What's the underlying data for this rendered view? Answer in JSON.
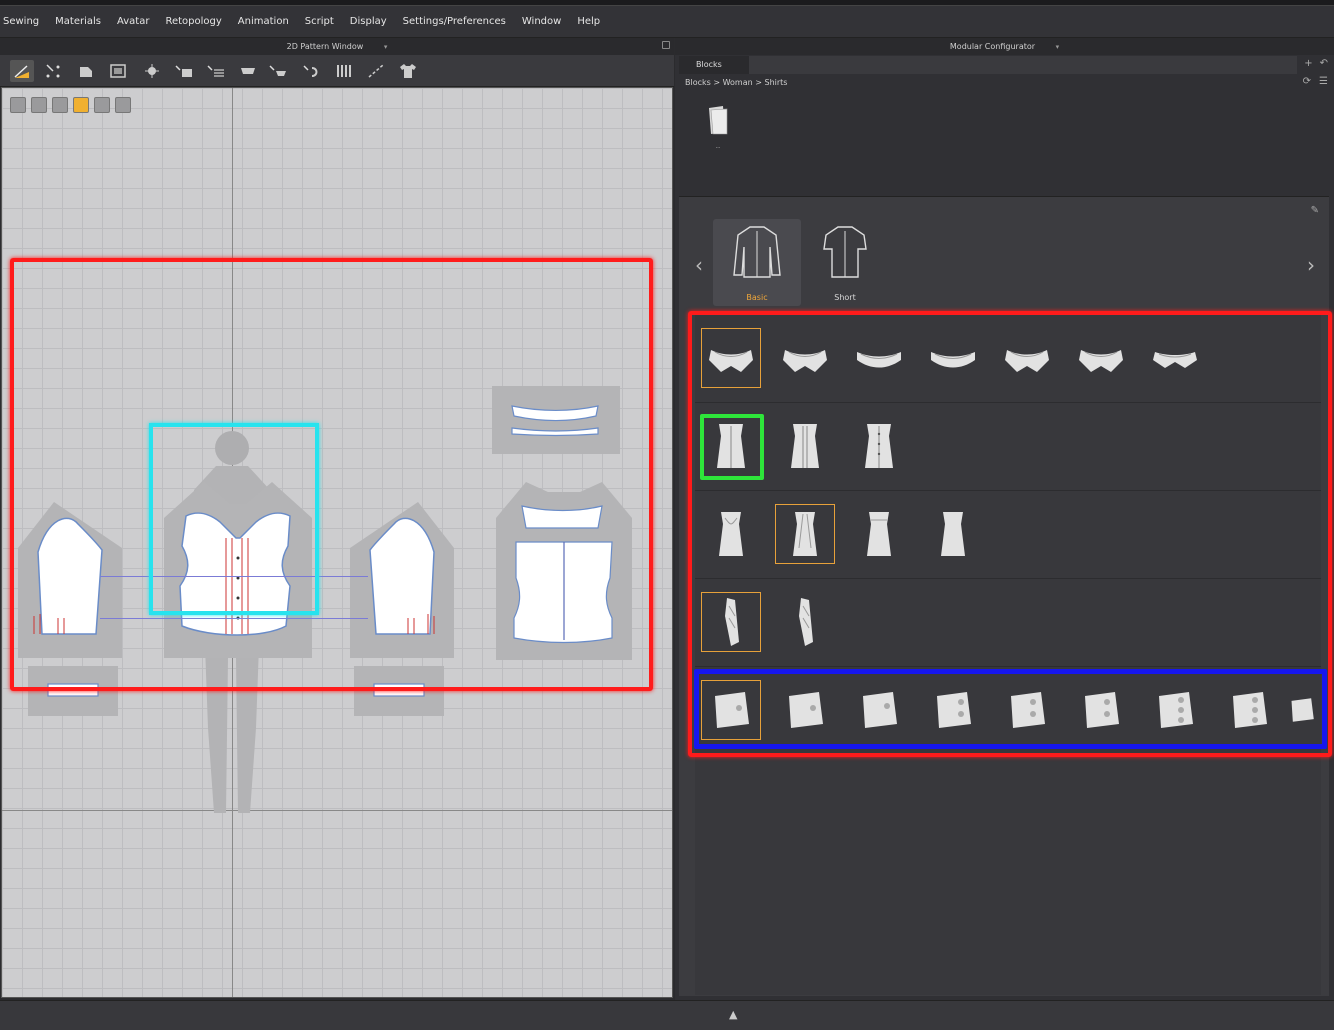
{
  "menu": [
    "Sewing",
    "Materials",
    "Avatar",
    "Retopology",
    "Animation",
    "Script",
    "Display",
    "Settings/Preferences",
    "Window",
    "Help"
  ],
  "pattern_window": {
    "title": "2D Pattern Window",
    "caret": "▾",
    "toolbar_icons": [
      "edit-pattern-icon",
      "transform-icon",
      "polygon-icon",
      "rectangle-icon",
      "internal-shape-icon",
      "dart-icon",
      "trace-icon",
      "segment-sewing-icon",
      "free-sewing-icon",
      "fold-arrange-icon",
      "elastic-icon",
      "measure-icon",
      "garment-icon"
    ],
    "canvas_tools": [
      "pen-icon",
      "select-icon",
      "texture-icon",
      "sticky-note-icon",
      "show-avatar-icon",
      "export-icon"
    ]
  },
  "configurator": {
    "title": "Modular Configurator",
    "caret": "▾",
    "tab": "Blocks",
    "breadcrumb": "Blocks > Woman > Shirts",
    "folder_label": "..",
    "styles": [
      {
        "label": "Basic",
        "selected": true
      },
      {
        "label": "Short",
        "selected": false
      }
    ],
    "rows": [
      {
        "name": "collars",
        "count": 7,
        "selected_index": 0
      },
      {
        "name": "front-bodice",
        "count": 3,
        "selected_index": 0
      },
      {
        "name": "back-bodice",
        "count": 4,
        "selected_index": 1
      },
      {
        "name": "sleeves",
        "count": 2,
        "selected_index": 0
      },
      {
        "name": "cuffs",
        "count": 9,
        "selected_index": 0
      }
    ]
  },
  "colors": {
    "highlight_red": "#ff1b1b",
    "highlight_cyan": "#27e3ee",
    "highlight_green": "#2ee53a",
    "highlight_blue": "#1616ee",
    "accent_orange": "#f0a73a"
  },
  "bottom": {
    "arrow": "▲"
  }
}
